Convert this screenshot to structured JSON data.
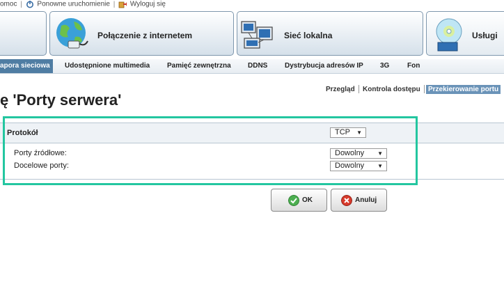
{
  "toplinks": {
    "help": "omoc",
    "restart": "Ponowne uruchomienie",
    "logout": "Wyloguj się"
  },
  "main_tabs": {
    "internet": "Połączenie z internetem",
    "lan": "Sieć lokalna",
    "services": "Usługi"
  },
  "subnav": [
    "apora sieciowa",
    "Udostępnione multimedia",
    "Pamięć zewnętrzna",
    "DDNS",
    "Dystrybucja adresów IP",
    "3G",
    "Fon"
  ],
  "subtabs": {
    "overview": "Przegląd",
    "access_control": "Kontrola dostępu",
    "port_forwarding": "Przekierowanie portu"
  },
  "page_title": "ę 'Porty serwera'",
  "form": {
    "protocol_label": "Protokół",
    "protocol_value": "TCP",
    "source_ports_label": "Porty źródłowe:",
    "source_ports_value": "Dowolny",
    "dest_ports_label": "Docelowe porty:",
    "dest_ports_value": "Dowolny"
  },
  "buttons": {
    "ok": "OK",
    "cancel": "Anuluj"
  },
  "colors": {
    "highlight": "#23c6a0",
    "active_nav": "#4f7da3"
  }
}
